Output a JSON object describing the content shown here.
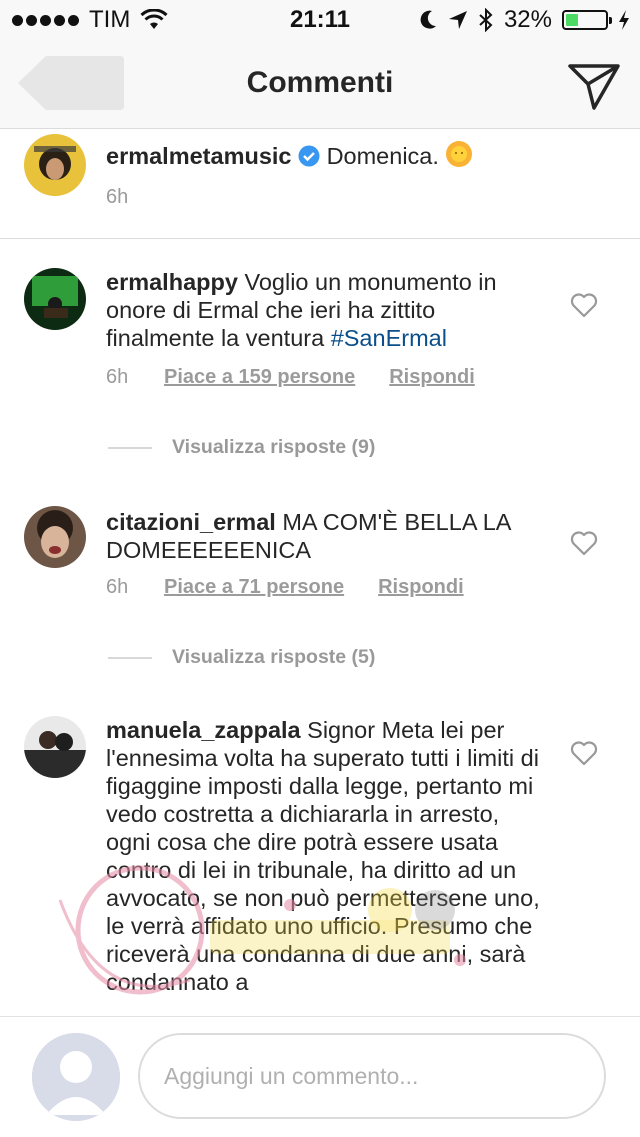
{
  "status_bar": {
    "carrier": "TIM",
    "time": "21:11",
    "battery_percent": "32%",
    "battery_level": 0.32
  },
  "nav": {
    "title": "Commenti"
  },
  "colors": {
    "hashtag": "#0b4f8a",
    "meta_gray": "#9b9b9b",
    "battery_green": "#4cd964"
  },
  "caption": {
    "username": "ermalmetamusic",
    "text": "Domenica.",
    "emoji": "sun-face-icon",
    "time": "6h"
  },
  "comments": [
    {
      "username": "ermalhappy",
      "text": "Voglio un monumento in onore di Ermal che ieri ha zittito finalmente la ventura",
      "hashtag": "#SanErmal",
      "time": "6h",
      "likes": "Piace a 159 persone",
      "reply": "Rispondi",
      "view_replies": "Visualizza risposte (9)"
    },
    {
      "username": "citazioni_ermal",
      "text": "MA COM'È BELLA LA DOMEEEEEENICA",
      "time": "6h",
      "likes": "Piace a 71 persone",
      "reply": "Rispondi",
      "view_replies": "Visualizza risposte (5)"
    },
    {
      "username": "manuela_zappala",
      "text": "Signor Meta lei per l'ennesima volta ha superato tutti i limiti di figaggine imposti dalla legge, pertanto mi vedo costretta a dichiararla in arresto, ogni cosa che dire potrà essere usata contro di lei in tribunale, ha diritto ad un avvocato, se non può permettersene uno, le verrà affidato uno ufficio. Presumo che riceverà una condanna di due anni, sarà condannato a"
    }
  ],
  "composer": {
    "placeholder": "Aggiungi un commento..."
  }
}
